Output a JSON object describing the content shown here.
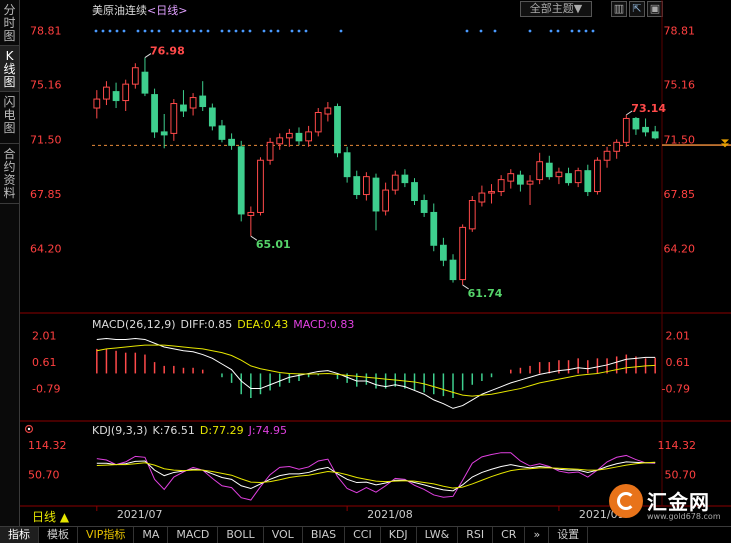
{
  "sidebar": {
    "tabs": [
      {
        "label": "分时图",
        "active": false
      },
      {
        "label": "K线图",
        "active": true
      },
      {
        "label": "闪电图",
        "active": false
      },
      {
        "label": "合约资料",
        "active": false
      }
    ]
  },
  "header": {
    "symbol": "美原油连续",
    "period": "<日线>",
    "theme_button": "全部主题▼",
    "window_buttons": [
      "▥",
      "⇱",
      "▣"
    ]
  },
  "price_panel": {
    "axis_labels": [
      "78.81",
      "75.16",
      "71.50",
      "67.85",
      "64.20"
    ],
    "current_price": "71.50",
    "high_labels": [
      {
        "text": "76.98",
        "color": "#ff4a4a"
      },
      {
        "text": "73.14",
        "color": "#ff4a4a"
      }
    ],
    "low_labels": [
      {
        "text": "65.01",
        "color": "#55d46a"
      },
      {
        "text": "61.74",
        "color": "#55d46a"
      }
    ]
  },
  "macd_panel": {
    "title": "MACD(26,12,9)",
    "diff": "DIFF:0.85",
    "dea": "DEA:0.43",
    "macd": "MACD:0.83",
    "axis_labels": [
      "2.01",
      "0.61",
      "-0.79"
    ]
  },
  "kdj_panel": {
    "title": "KDJ(9,3,3)",
    "k": "K:76.51",
    "d": "D:77.29",
    "j": "J:74.95",
    "axis_labels": [
      "114.32",
      "50.70"
    ]
  },
  "x_axis": {
    "period_label": "日线 ▲",
    "dates": [
      "2021/07",
      "2021/08",
      "2021/09"
    ]
  },
  "bottom_tabs": [
    {
      "label": "指标",
      "active": true
    },
    {
      "label": "模板",
      "active": false
    },
    {
      "label": "VIP指标",
      "vip": true
    },
    {
      "label": "MA"
    },
    {
      "label": "MACD"
    },
    {
      "label": "BOLL"
    },
    {
      "label": "VOL"
    },
    {
      "label": "BIAS"
    },
    {
      "label": "CCI"
    },
    {
      "label": "KDJ"
    },
    {
      "label": "LW&"
    },
    {
      "label": "RSI"
    },
    {
      "label": "CR"
    },
    {
      "label": "»"
    },
    {
      "label": "设置"
    }
  ],
  "logo": {
    "name": "汇金网",
    "url": "www.gold678.com"
  },
  "colors": {
    "up": "#ff4a4a",
    "down": "#3ecf8e",
    "diff_line": "#ffffff",
    "dea_line": "#e6e600",
    "j_line": "#e040e0",
    "axis_text": "#ff4040"
  },
  "chart_data": {
    "type": "candlestick",
    "ylim": [
      61.0,
      79.5
    ],
    "candles": [
      {
        "o": 73.6,
        "h": 74.8,
        "l": 72.9,
        "c": 74.2
      },
      {
        "o": 74.2,
        "h": 75.4,
        "l": 73.8,
        "c": 75.0
      },
      {
        "o": 74.7,
        "h": 75.3,
        "l": 73.6,
        "c": 74.1
      },
      {
        "o": 74.1,
        "h": 75.5,
        "l": 73.4,
        "c": 75.2
      },
      {
        "o": 75.2,
        "h": 76.6,
        "l": 74.9,
        "c": 76.3
      },
      {
        "o": 76.0,
        "h": 76.98,
        "l": 74.4,
        "c": 74.6
      },
      {
        "o": 74.5,
        "h": 74.9,
        "l": 71.6,
        "c": 72.0
      },
      {
        "o": 72.0,
        "h": 73.2,
        "l": 70.9,
        "c": 71.8
      },
      {
        "o": 71.9,
        "h": 74.2,
        "l": 71.4,
        "c": 73.9
      },
      {
        "o": 73.8,
        "h": 74.8,
        "l": 73.0,
        "c": 73.4
      },
      {
        "o": 73.6,
        "h": 74.6,
        "l": 73.1,
        "c": 74.3
      },
      {
        "o": 74.4,
        "h": 75.4,
        "l": 73.4,
        "c": 73.7
      },
      {
        "o": 73.6,
        "h": 73.9,
        "l": 72.1,
        "c": 72.4
      },
      {
        "o": 72.4,
        "h": 72.8,
        "l": 71.3,
        "c": 71.5
      },
      {
        "o": 71.5,
        "h": 71.9,
        "l": 70.8,
        "c": 71.1
      },
      {
        "o": 71.0,
        "h": 71.4,
        "l": 66.0,
        "c": 66.5
      },
      {
        "o": 66.4,
        "h": 67.0,
        "l": 65.01,
        "c": 66.6
      },
      {
        "o": 66.6,
        "h": 70.3,
        "l": 66.4,
        "c": 70.1
      },
      {
        "o": 70.1,
        "h": 71.6,
        "l": 69.8,
        "c": 71.3
      },
      {
        "o": 71.2,
        "h": 71.9,
        "l": 70.8,
        "c": 71.6
      },
      {
        "o": 71.6,
        "h": 72.2,
        "l": 71.0,
        "c": 71.9
      },
      {
        "o": 71.9,
        "h": 72.3,
        "l": 71.1,
        "c": 71.4
      },
      {
        "o": 71.4,
        "h": 72.4,
        "l": 71.0,
        "c": 72.0
      },
      {
        "o": 72.0,
        "h": 73.6,
        "l": 71.7,
        "c": 73.3
      },
      {
        "o": 73.2,
        "h": 74.0,
        "l": 72.7,
        "c": 73.6
      },
      {
        "o": 73.7,
        "h": 73.9,
        "l": 70.3,
        "c": 70.6
      },
      {
        "o": 70.6,
        "h": 71.0,
        "l": 68.6,
        "c": 69.0
      },
      {
        "o": 69.0,
        "h": 69.4,
        "l": 67.5,
        "c": 67.8
      },
      {
        "o": 67.8,
        "h": 69.3,
        "l": 67.4,
        "c": 69.0
      },
      {
        "o": 68.9,
        "h": 69.2,
        "l": 65.4,
        "c": 66.7
      },
      {
        "o": 66.7,
        "h": 68.6,
        "l": 66.4,
        "c": 68.1
      },
      {
        "o": 68.1,
        "h": 69.4,
        "l": 67.8,
        "c": 69.1
      },
      {
        "o": 69.1,
        "h": 69.5,
        "l": 68.3,
        "c": 68.6
      },
      {
        "o": 68.6,
        "h": 68.9,
        "l": 67.1,
        "c": 67.4
      },
      {
        "o": 67.4,
        "h": 67.8,
        "l": 66.3,
        "c": 66.6
      },
      {
        "o": 66.6,
        "h": 67.2,
        "l": 64.0,
        "c": 64.4
      },
      {
        "o": 64.4,
        "h": 64.9,
        "l": 63.0,
        "c": 63.4
      },
      {
        "o": 63.4,
        "h": 63.8,
        "l": 61.9,
        "c": 62.1
      },
      {
        "o": 62.1,
        "h": 65.8,
        "l": 61.74,
        "c": 65.6
      },
      {
        "o": 65.5,
        "h": 67.7,
        "l": 65.3,
        "c": 67.4
      },
      {
        "o": 67.3,
        "h": 68.4,
        "l": 67.0,
        "c": 67.9
      },
      {
        "o": 67.9,
        "h": 68.5,
        "l": 67.2,
        "c": 68.0
      },
      {
        "o": 68.0,
        "h": 69.1,
        "l": 67.7,
        "c": 68.8
      },
      {
        "o": 68.7,
        "h": 69.5,
        "l": 68.2,
        "c": 69.2
      },
      {
        "o": 69.1,
        "h": 69.4,
        "l": 68.0,
        "c": 68.5
      },
      {
        "o": 68.5,
        "h": 69.1,
        "l": 67.1,
        "c": 68.7
      },
      {
        "o": 68.8,
        "h": 70.6,
        "l": 68.5,
        "c": 70.0
      },
      {
        "o": 69.9,
        "h": 70.4,
        "l": 68.8,
        "c": 69.0
      },
      {
        "o": 69.0,
        "h": 69.6,
        "l": 68.5,
        "c": 69.3
      },
      {
        "o": 69.2,
        "h": 69.6,
        "l": 68.4,
        "c": 68.6
      },
      {
        "o": 68.6,
        "h": 69.6,
        "l": 68.3,
        "c": 69.4
      },
      {
        "o": 69.4,
        "h": 69.8,
        "l": 67.7,
        "c": 68.0
      },
      {
        "o": 68.0,
        "h": 70.3,
        "l": 67.8,
        "c": 70.1
      },
      {
        "o": 70.1,
        "h": 71.0,
        "l": 69.6,
        "c": 70.7
      },
      {
        "o": 70.7,
        "h": 71.5,
        "l": 70.2,
        "c": 71.3
      },
      {
        "o": 71.3,
        "h": 73.14,
        "l": 71.0,
        "c": 72.9
      },
      {
        "o": 72.9,
        "h": 73.0,
        "l": 71.8,
        "c": 72.2
      },
      {
        "o": 72.3,
        "h": 72.9,
        "l": 71.7,
        "c": 72.0
      },
      {
        "o": 72.0,
        "h": 72.4,
        "l": 71.5,
        "c": 71.6
      }
    ],
    "macd_ylim": [
      -2.2,
      2.3
    ],
    "macd_hist": [
      1.3,
      1.3,
      1.2,
      1.1,
      1.1,
      1.0,
      0.6,
      0.4,
      0.4,
      0.3,
      0.3,
      0.2,
      0.0,
      -0.2,
      -0.5,
      -1.1,
      -1.3,
      -1.1,
      -0.9,
      -0.7,
      -0.5,
      -0.4,
      -0.2,
      -0.1,
      0.0,
      -0.3,
      -0.5,
      -0.7,
      -0.6,
      -0.8,
      -0.8,
      -0.7,
      -0.8,
      -0.9,
      -1.0,
      -1.1,
      -1.2,
      -1.3,
      -0.9,
      -0.6,
      -0.4,
      -0.2,
      0.0,
      0.2,
      0.3,
      0.4,
      0.6,
      0.6,
      0.7,
      0.7,
      0.8,
      0.7,
      0.8,
      0.8,
      0.9,
      1.0,
      0.9,
      0.8,
      0.83
    ],
    "diff": [
      1.8,
      1.85,
      1.8,
      1.8,
      1.85,
      1.8,
      1.6,
      1.4,
      1.3,
      1.2,
      1.15,
      1.0,
      0.8,
      0.5,
      0.2,
      -0.4,
      -0.8,
      -0.8,
      -0.6,
      -0.4,
      -0.2,
      -0.1,
      0.0,
      0.1,
      0.15,
      0.0,
      -0.2,
      -0.4,
      -0.4,
      -0.6,
      -0.7,
      -0.6,
      -0.7,
      -0.9,
      -1.1,
      -1.4,
      -1.6,
      -1.85,
      -1.7,
      -1.4,
      -1.1,
      -0.9,
      -0.7,
      -0.5,
      -0.35,
      -0.2,
      -0.05,
      0.05,
      0.15,
      0.2,
      0.3,
      0.25,
      0.35,
      0.45,
      0.6,
      0.75,
      0.8,
      0.85,
      0.85
    ],
    "dea": [
      1.2,
      1.3,
      1.35,
      1.4,
      1.45,
      1.5,
      1.5,
      1.5,
      1.45,
      1.4,
      1.35,
      1.3,
      1.2,
      1.1,
      0.95,
      0.7,
      0.4,
      0.25,
      0.15,
      0.05,
      0.0,
      -0.02,
      -0.03,
      -0.02,
      0.0,
      -0.05,
      -0.1,
      -0.15,
      -0.2,
      -0.25,
      -0.3,
      -0.35,
      -0.4,
      -0.45,
      -0.55,
      -0.7,
      -0.85,
      -1.0,
      -1.15,
      -1.2,
      -1.15,
      -1.1,
      -1.0,
      -0.9,
      -0.8,
      -0.65,
      -0.5,
      -0.4,
      -0.3,
      -0.2,
      -0.1,
      -0.05,
      0.0,
      0.1,
      0.2,
      0.3,
      0.35,
      0.4,
      0.43
    ],
    "kdj_ylim": [
      -5,
      130
    ],
    "k": [
      75,
      75,
      72,
      74,
      79,
      80,
      60,
      48,
      55,
      58,
      62,
      60,
      52,
      44,
      40,
      26,
      20,
      30,
      40,
      48,
      52,
      52,
      55,
      62,
      66,
      52,
      40,
      33,
      34,
      28,
      32,
      38,
      38,
      33,
      28,
      22,
      17,
      15,
      28,
      45,
      55,
      62,
      68,
      72,
      68,
      65,
      68,
      66,
      62,
      60,
      60,
      55,
      60,
      68,
      74,
      78,
      77,
      76,
      76.51
    ],
    "d": [
      70,
      71,
      72,
      72,
      74,
      76,
      71,
      63,
      60,
      59,
      60,
      60,
      57,
      53,
      49,
      41,
      34,
      33,
      35,
      39,
      44,
      47,
      49,
      53,
      57,
      55,
      50,
      44,
      40,
      36,
      35,
      36,
      37,
      36,
      33,
      30,
      25,
      21,
      23,
      30,
      38,
      46,
      53,
      59,
      62,
      63,
      65,
      65,
      64,
      63,
      62,
      60,
      60,
      63,
      67,
      71,
      74,
      76,
      77.29
    ],
    "j": [
      85,
      82,
      72,
      78,
      90,
      88,
      40,
      18,
      45,
      56,
      66,
      60,
      42,
      26,
      22,
      0,
      -5,
      24,
      50,
      66,
      68,
      62,
      67,
      80,
      84,
      46,
      20,
      11,
      22,
      12,
      26,
      42,
      40,
      27,
      18,
      6,
      1,
      3,
      38,
      75,
      89,
      94,
      98,
      98,
      80,
      69,
      74,
      68,
      58,
      54,
      56,
      45,
      60,
      78,
      88,
      92,
      83,
      76,
      74.95
    ]
  }
}
